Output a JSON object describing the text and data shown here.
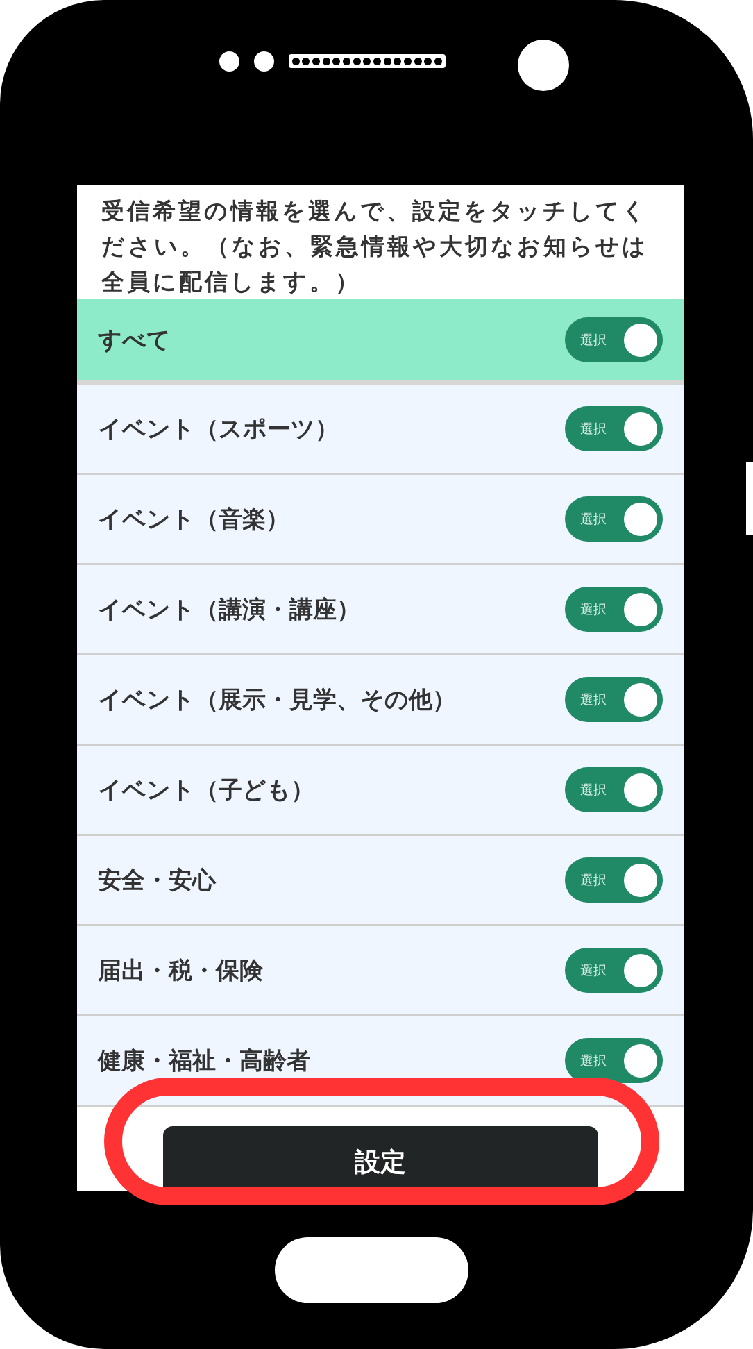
{
  "intro": "受信希望の情報を選んで、設定をタッチしてください。（なお、緊急情報や大切なお知らせは全員に配信します。）",
  "rows": [
    {
      "label": "すべて",
      "selected": true,
      "toggle_text": "選択",
      "on": true
    },
    {
      "label": "イベント（スポーツ）",
      "selected": false,
      "toggle_text": "選択",
      "on": true
    },
    {
      "label": "イベント（音楽）",
      "selected": false,
      "toggle_text": "選択",
      "on": true
    },
    {
      "label": "イベント（講演・講座）",
      "selected": false,
      "toggle_text": "選択",
      "on": true
    },
    {
      "label": "イベント（展示・見学、その他）",
      "selected": false,
      "toggle_text": "選択",
      "on": true
    },
    {
      "label": "イベント（子ども）",
      "selected": false,
      "toggle_text": "選択",
      "on": true
    },
    {
      "label": "安全・安心",
      "selected": false,
      "toggle_text": "選択",
      "on": true
    },
    {
      "label": "届出・税・保険",
      "selected": false,
      "toggle_text": "選択",
      "on": true
    },
    {
      "label": "健康・福祉・高齢者",
      "selected": false,
      "toggle_text": "選択",
      "on": true
    }
  ],
  "button": {
    "label": "設定",
    "circled": true
  }
}
